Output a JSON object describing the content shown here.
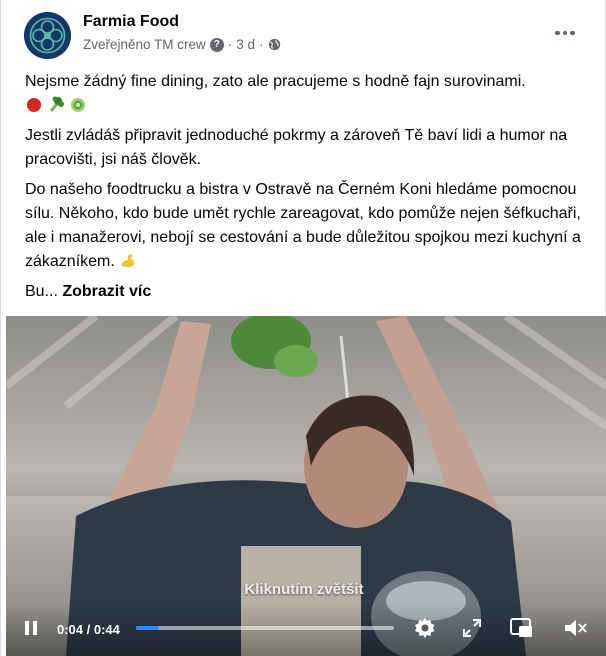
{
  "post": {
    "author": "Farmia Food",
    "meta_prefix": "Zveřejněno TM crew",
    "meta_sep": "·",
    "time": "3 d",
    "paragraph_1": "Nejsme žádný fine dining, zato ale pracujeme s hodně fajn surovinami.",
    "paragraph_1_emojis": [
      "tomato",
      "broccoli",
      "leafy-green"
    ],
    "paragraph_2": "Jestli zvládáš připravit jednoduché pokrmy a zároveň Tě baví lidi a humor na pracovišti, jsi náš člověk.",
    "paragraph_3": "Do našeho foodtrucku a bistra v Ostravě na Černém Koni hledáme pomocnou sílu. Někoho, kdo bude umět rychle zareagovat, kdo pomůže nejen šéfkuchaři, ale i manažerovi, nebojí se cestování a bude důležitou spojkou mezi kuchyní a zákazníkem.",
    "paragraph_3_emoji": "flexed-biceps",
    "truncated_start": "Bu...",
    "see_more": "Zobrazit víc"
  },
  "video": {
    "hint": "Kliknutím zvětšit",
    "time_display": "0:04 / 0:44",
    "progress": 0.09,
    "accent": "#2d88ff",
    "controls": [
      "pause-icon",
      "settings-icon",
      "fullscreen-icon",
      "mini-player-icon",
      "muted-icon"
    ]
  }
}
